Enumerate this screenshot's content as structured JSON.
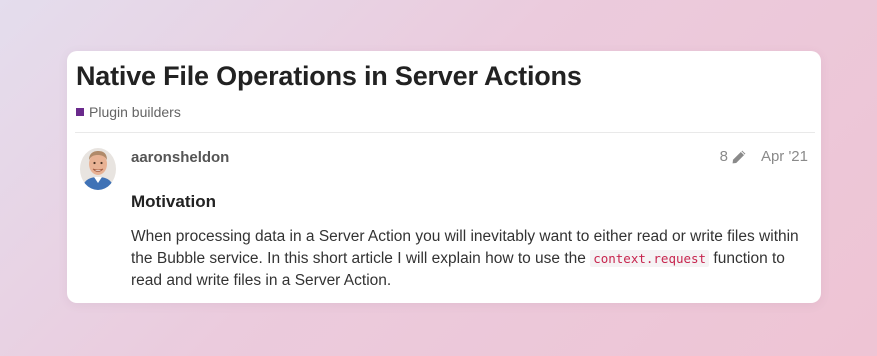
{
  "topic": {
    "title": "Native File Operations in Server Actions",
    "category": {
      "label": "Plugin builders",
      "color": "#6a2a8c"
    }
  },
  "post": {
    "author": "aaronsheldon",
    "edit_count": "8",
    "edit_icon": "pencil-icon",
    "date": "Apr '21",
    "heading": "Motivation",
    "body": {
      "part1": "When processing data in a Server Action you will inevitably want to either read or write files within the Bubble service. In this short article I will explain how to use the ",
      "code": "context.request",
      "part2": " function to read and write files in a Server Action."
    }
  },
  "colors": {
    "background_start": "#e4dded",
    "background_end": "#eec4d4",
    "card": "#ffffff",
    "code_text": "#c7254e"
  }
}
